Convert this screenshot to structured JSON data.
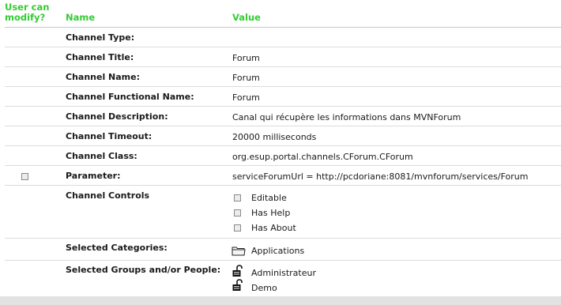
{
  "header": {
    "user_can_modify": "User can modify?",
    "name": "Name",
    "value": "Value"
  },
  "rows": [
    {
      "name": "Channel Type:",
      "value": ""
    },
    {
      "name": "Channel Title:",
      "value": "Forum"
    },
    {
      "name": "Channel Name:",
      "value": "Forum"
    },
    {
      "name": "Channel Functional Name:",
      "value": "Forum"
    },
    {
      "name": "Channel Description:",
      "value": "Canal qui récupère les informations dans MVNForum"
    },
    {
      "name": "Channel Timeout:",
      "value": "20000 milliseconds"
    },
    {
      "name": "Channel Class:",
      "value": "org.esup.portal.channels.CForum.CForum"
    },
    {
      "name": "Parameter:",
      "value": "serviceForumUrl = http://pcdoriane:8081/mvnforum/services/Forum"
    }
  ],
  "controls": {
    "label": "Channel Controls",
    "items": [
      "Editable",
      "Has Help",
      "Has About"
    ]
  },
  "categories": {
    "label": "Selected Categories:",
    "items": [
      {
        "name": "Applications",
        "icon": "folder-icon"
      }
    ]
  },
  "groups": {
    "label": "Selected Groups and/or People:",
    "items": [
      {
        "name": "Administrateur",
        "icon": "padlock-open-icon"
      },
      {
        "name": "Demo",
        "icon": "padlock-open-icon"
      }
    ]
  },
  "colors": {
    "header": "#33cc33",
    "divider": "#dcdcdc",
    "footer": "#e2e2e2"
  }
}
